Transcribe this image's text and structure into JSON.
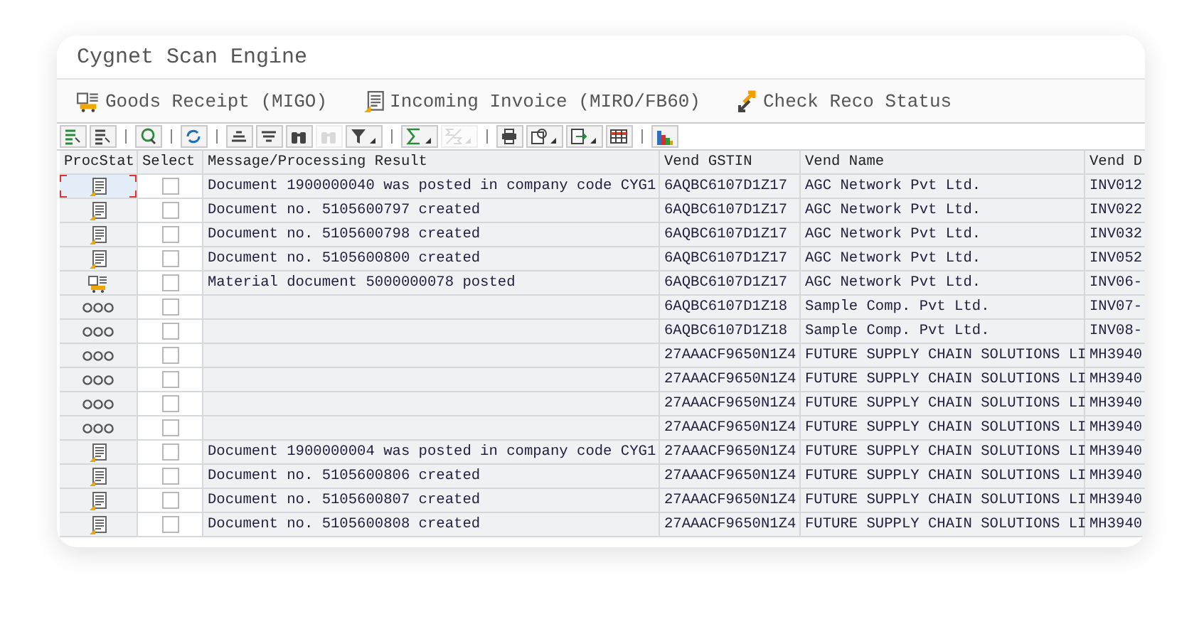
{
  "window": {
    "title": "Cygnet Scan Engine"
  },
  "actions": [
    {
      "kind": "goods",
      "label": "Goods Receipt (MIGO)"
    },
    {
      "kind": "invoice",
      "label": "Incoming Invoice (MIRO/FB60)"
    },
    {
      "kind": "reco",
      "label": "Check Reco Status"
    }
  ],
  "toolbar": [
    {
      "kind": "details",
      "disabled": false,
      "menu": false
    },
    {
      "kind": "details2",
      "disabled": false,
      "menu": false
    },
    {
      "kind": "separator"
    },
    {
      "kind": "check",
      "disabled": false,
      "menu": false
    },
    {
      "kind": "separator"
    },
    {
      "kind": "refresh",
      "disabled": false,
      "menu": false
    },
    {
      "kind": "separator"
    },
    {
      "kind": "sort-asc",
      "disabled": false,
      "menu": false
    },
    {
      "kind": "sort-desc",
      "disabled": false,
      "menu": false
    },
    {
      "kind": "find",
      "disabled": false,
      "menu": false
    },
    {
      "kind": "find",
      "disabled": true,
      "menu": false
    },
    {
      "kind": "filter",
      "disabled": false,
      "menu": true
    },
    {
      "kind": "separator"
    },
    {
      "kind": "sum",
      "disabled": false,
      "menu": true
    },
    {
      "kind": "subtotal",
      "disabled": true,
      "menu": true
    },
    {
      "kind": "separator"
    },
    {
      "kind": "print",
      "disabled": false,
      "menu": false
    },
    {
      "kind": "export",
      "disabled": false,
      "menu": true
    },
    {
      "kind": "send",
      "disabled": false,
      "menu": true
    },
    {
      "kind": "layout",
      "disabled": false,
      "menu": false
    },
    {
      "kind": "separator"
    },
    {
      "kind": "chart",
      "disabled": false,
      "menu": false
    }
  ],
  "table": {
    "columns": [
      "ProcStat",
      "Select",
      "Message/Processing Result",
      "Vend GSTIN",
      "Vend Name",
      "Vend D"
    ],
    "rows": [
      {
        "kind": "invoice",
        "selected": true,
        "checked": false,
        "message": "Document 1900000040 was posted in company code CYG1",
        "gstin": "6AQBC6107D1Z17",
        "name": "AGC Network Pvt Ltd.",
        "column_6": "INV012"
      },
      {
        "kind": "invoice",
        "selected": false,
        "checked": false,
        "message": "Document no. 5105600797 created",
        "gstin": "6AQBC6107D1Z17",
        "name": "AGC Network Pvt Ltd.",
        "column_6": "INV022"
      },
      {
        "kind": "invoice",
        "selected": false,
        "checked": false,
        "message": "Document no. 5105600798 created",
        "gstin": "6AQBC6107D1Z17",
        "name": "AGC Network Pvt Ltd.",
        "column_6": "INV032"
      },
      {
        "kind": "invoice",
        "selected": false,
        "checked": false,
        "message": "Document no. 5105600800 created",
        "gstin": "6AQBC6107D1Z17",
        "name": "AGC Network Pvt Ltd.",
        "column_6": "INV052"
      },
      {
        "kind": "goods",
        "selected": false,
        "checked": false,
        "message": "Material document 5000000078 posted",
        "gstin": "6AQBC6107D1Z17",
        "name": "AGC Network Pvt Ltd.",
        "column_6": "INV06-"
      },
      {
        "kind": "pending",
        "selected": false,
        "checked": false,
        "gstin": "6AQBC6107D1Z18",
        "name": "Sample Comp. Pvt Ltd.",
        "column_6": "INV07-"
      },
      {
        "kind": "pending",
        "selected": false,
        "checked": false,
        "gstin": "6AQBC6107D1Z18",
        "name": "Sample Comp. Pvt Ltd.",
        "column_6": "INV08-"
      },
      {
        "kind": "pending",
        "selected": false,
        "checked": false,
        "gstin": "27AAACF9650N1Z4",
        "name": "FUTURE SUPPLY CHAIN SOLUTIONS LI",
        "column_6": "MH3940"
      },
      {
        "kind": "pending",
        "selected": false,
        "checked": false,
        "gstin": "27AAACF9650N1Z4",
        "name": "FUTURE SUPPLY CHAIN SOLUTIONS LI",
        "column_6": "MH3940"
      },
      {
        "kind": "pending",
        "selected": false,
        "checked": false,
        "gstin": "27AAACF9650N1Z4",
        "name": "FUTURE SUPPLY CHAIN SOLUTIONS LI",
        "column_6": "MH3940"
      },
      {
        "kind": "pending",
        "selected": false,
        "checked": false,
        "gstin": "27AAACF9650N1Z4",
        "name": "FUTURE SUPPLY CHAIN SOLUTIONS LI",
        "column_6": "MH3940"
      },
      {
        "kind": "invoice",
        "selected": false,
        "checked": false,
        "message": "Document 1900000004 was posted in company code CYG1",
        "gstin": "27AAACF9650N1Z4",
        "name": "FUTURE SUPPLY CHAIN SOLUTIONS LI",
        "column_6": "MH3940"
      },
      {
        "kind": "invoice",
        "selected": false,
        "checked": false,
        "message": "Document no. 5105600806 created",
        "gstin": "27AAACF9650N1Z4",
        "name": "FUTURE SUPPLY CHAIN SOLUTIONS LI",
        "column_6": "MH3940"
      },
      {
        "kind": "invoice",
        "selected": false,
        "checked": false,
        "message": "Document no. 5105600807 created",
        "gstin": "27AAACF9650N1Z4",
        "name": "FUTURE SUPPLY CHAIN SOLUTIONS LI",
        "column_6": "MH3940"
      },
      {
        "kind": "invoice",
        "selected": false,
        "checked": false,
        "message": "Document no. 5105600808 created",
        "gstin": "27AAACF9650N1Z4",
        "name": "FUTURE SUPPLY CHAIN SOLUTIONS LI",
        "column_6": "MH3940"
      }
    ]
  }
}
